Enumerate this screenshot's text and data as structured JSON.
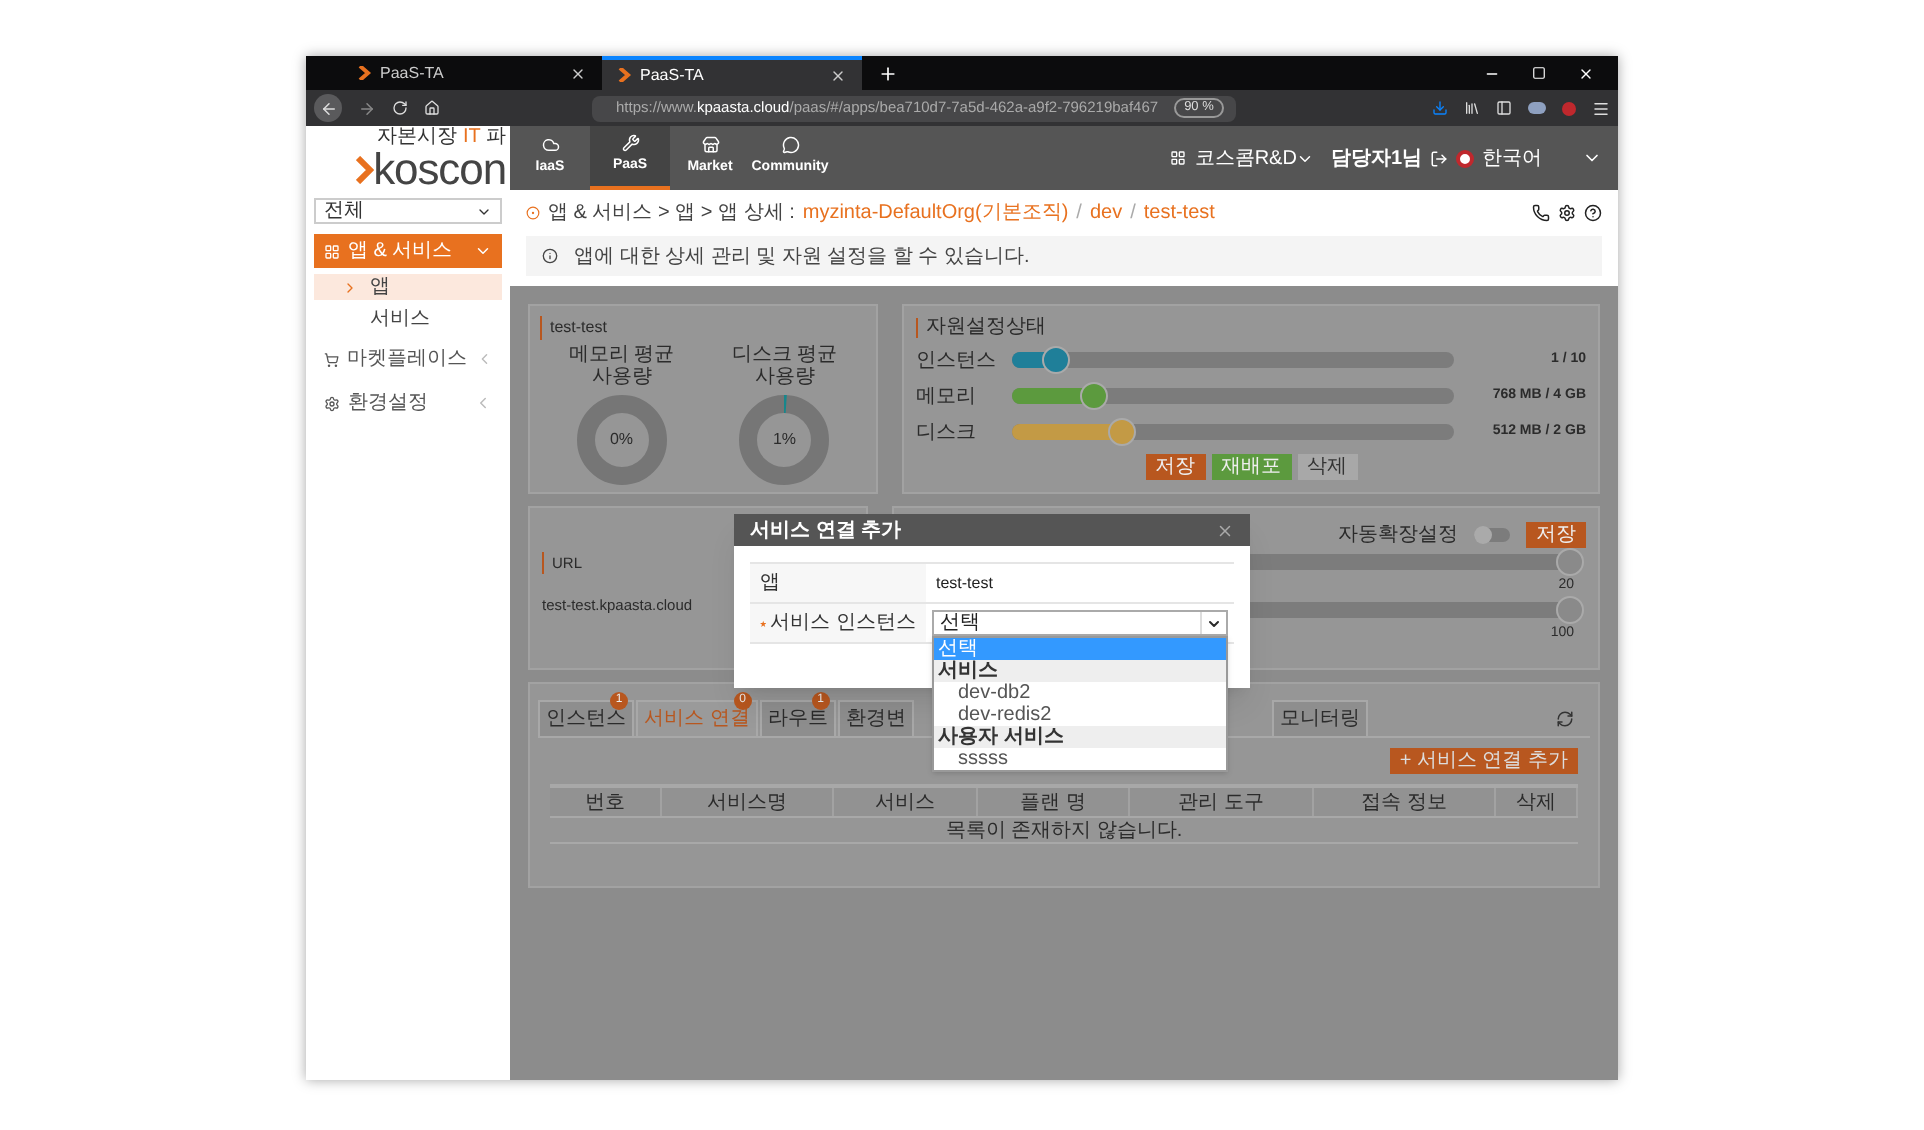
{
  "browser": {
    "tabs": [
      {
        "title": "PaaS-TA",
        "selected": false
      },
      {
        "title": "PaaS-TA",
        "selected": true
      }
    ],
    "url": {
      "prefix": "https://www.",
      "domain": "kpaasta.cloud",
      "path": "/paas/#/apps/bea710d7-7a5d-462a-a9f2-796219baf467"
    },
    "zoom": "90 %"
  },
  "header": {
    "logo": {
      "tagline_before": "자본시장 ",
      "tagline_accent": "IT",
      "tagline_after": " 파",
      "name": "koscon"
    },
    "nav": [
      {
        "label": "IaaS",
        "selected": false
      },
      {
        "label": "PaaS",
        "selected": true
      },
      {
        "label": "Market",
        "selected": false
      },
      {
        "label": "Community",
        "selected": false
      }
    ],
    "org": "코스콤R&D",
    "user": "담당자1님",
    "language": "한국어"
  },
  "sidebar": {
    "filter": "전체",
    "menu": [
      {
        "label": "앱 & 서비스",
        "expanded": true,
        "children": [
          {
            "label": "앱",
            "selected": true
          },
          {
            "label": "서비스",
            "selected": false
          }
        ]
      },
      {
        "label": "마켓플레이스",
        "expanded": false
      },
      {
        "label": "환경설정",
        "expanded": false
      }
    ]
  },
  "breadcrumb": {
    "path": "앱 & 서비스 > 앱 > 앱 상세 :",
    "trail": [
      {
        "kind": "link",
        "text": "myzinta-DefaultOrg(기본조직)"
      },
      {
        "kind": "separator",
        "text": "/"
      },
      {
        "kind": "link",
        "text": "dev"
      },
      {
        "kind": "separator",
        "text": "/"
      },
      {
        "kind": "link",
        "text": "test-test"
      }
    ]
  },
  "info": "앱에 대한 상세 관리 및 자원 설정을 할 수 있습니다.",
  "usage": {
    "title": "test-test",
    "meters": [
      {
        "label": "메모리 평균 사용량",
        "level": 0,
        "reading": "0%"
      },
      {
        "label": "디스크 평균 사용량",
        "level": 0.01,
        "reading": "1%"
      }
    ]
  },
  "resources": {
    "title": "자원설정상태",
    "sliders": [
      {
        "label": "인스턴스",
        "level": 0.1,
        "reading": "1 / 10",
        "color": "#1f7f99"
      },
      {
        "label": "메모리",
        "level": 0.1875,
        "reading": "768 MB / 4 GB",
        "color": "#5c9a3e"
      },
      {
        "label": "디스크",
        "level": 0.25,
        "reading": "512 MB / 2 GB",
        "color": "#c39a45"
      }
    ],
    "buttons": [
      {
        "label": "저장",
        "kind": "primary"
      },
      {
        "label": "재배포",
        "kind": "success"
      },
      {
        "label": "삭제",
        "kind": "default"
      }
    ]
  },
  "url_card": {
    "title": "URL",
    "value": "test-test.kpaasta.cloud"
  },
  "autoscale": {
    "label": "자동확장설정",
    "on": false,
    "button": "저장",
    "sliders": [
      {
        "level": 1,
        "reading": "20"
      },
      {
        "level": 1,
        "reading": "100"
      }
    ]
  },
  "detail_tabs": {
    "tabs": [
      {
        "label": "인스턴스",
        "count": "1",
        "selected": false
      },
      {
        "label": "서비스 연결",
        "count": "0",
        "selected": true
      },
      {
        "label": "라우트",
        "count": "1",
        "selected": false
      },
      {
        "label": "환경변",
        "selected": false
      },
      {
        "label": "모니터링",
        "selected": false
      }
    ],
    "add_button": "+ 서비스 연결 추가",
    "table": {
      "columns": [
        "번호",
        "서비스명",
        "서비스",
        "플랜 명",
        "관리 도구",
        "접속 정보",
        "삭제"
      ],
      "empty": "목록이 존재하지 않습니다."
    }
  },
  "modal": {
    "title": "서비스 연결 추가",
    "rows": [
      {
        "kind": "text",
        "label": "앱",
        "required": false,
        "value": "test-test"
      },
      {
        "kind": "select",
        "label": "서비스 인스턴스",
        "required": true,
        "value": "선택"
      }
    ],
    "options": [
      {
        "kind": "option",
        "label": "선택",
        "selected": true
      },
      {
        "kind": "group",
        "label": "서비스"
      },
      {
        "kind": "option",
        "label": "dev-db2",
        "selected": false
      },
      {
        "kind": "option",
        "label": "dev-redis2",
        "selected": false
      },
      {
        "kind": "group",
        "label": "사용자 서비스"
      },
      {
        "kind": "option",
        "label": "sssss",
        "selected": false
      }
    ]
  }
}
